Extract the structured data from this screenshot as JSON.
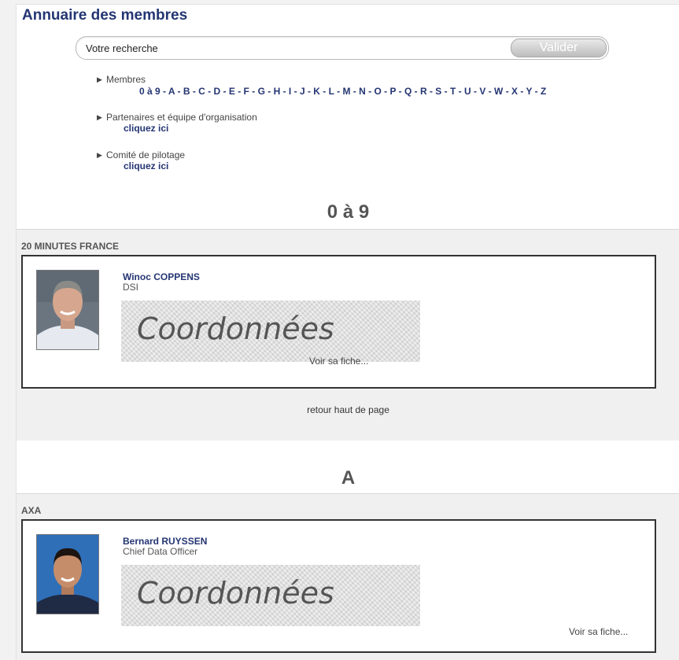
{
  "header": {
    "title": "Annuaire des membres"
  },
  "search": {
    "placeholder": "Votre recherche",
    "button": "Valider"
  },
  "nav": {
    "members_label": "Membres",
    "alphabet": [
      "0 à 9",
      "A",
      "B",
      "C",
      "D",
      "E",
      "F",
      "G",
      "H",
      "I",
      "J",
      "K",
      "L",
      "M",
      "N",
      "O",
      "P",
      "Q",
      "R",
      "S",
      "T",
      "U",
      "V",
      "W",
      "X",
      "Y",
      "Z"
    ],
    "partners_label": "Partenaires et équipe d'organisation",
    "partners_link": "cliquez ici",
    "committee_label": "Comité de pilotage",
    "committee_link": "cliquez ici"
  },
  "sections": [
    {
      "heading": "0 à 9",
      "company": "20 MINUTES FRANCE",
      "member": {
        "name": "Winoc COPPENS",
        "role": "DSI",
        "coord": "Coordonnées",
        "fiche": "Voir sa fiche..."
      },
      "retour": "retour haut de page"
    },
    {
      "heading": "A",
      "company": "AXA",
      "member": {
        "name": "Bernard RUYSSEN",
        "role": "Chief Data Officer",
        "coord": "Coordonnées",
        "fiche": "Voir sa fiche..."
      }
    }
  ],
  "colors": {
    "link": "#243573",
    "panel": "#f0f0f0"
  }
}
